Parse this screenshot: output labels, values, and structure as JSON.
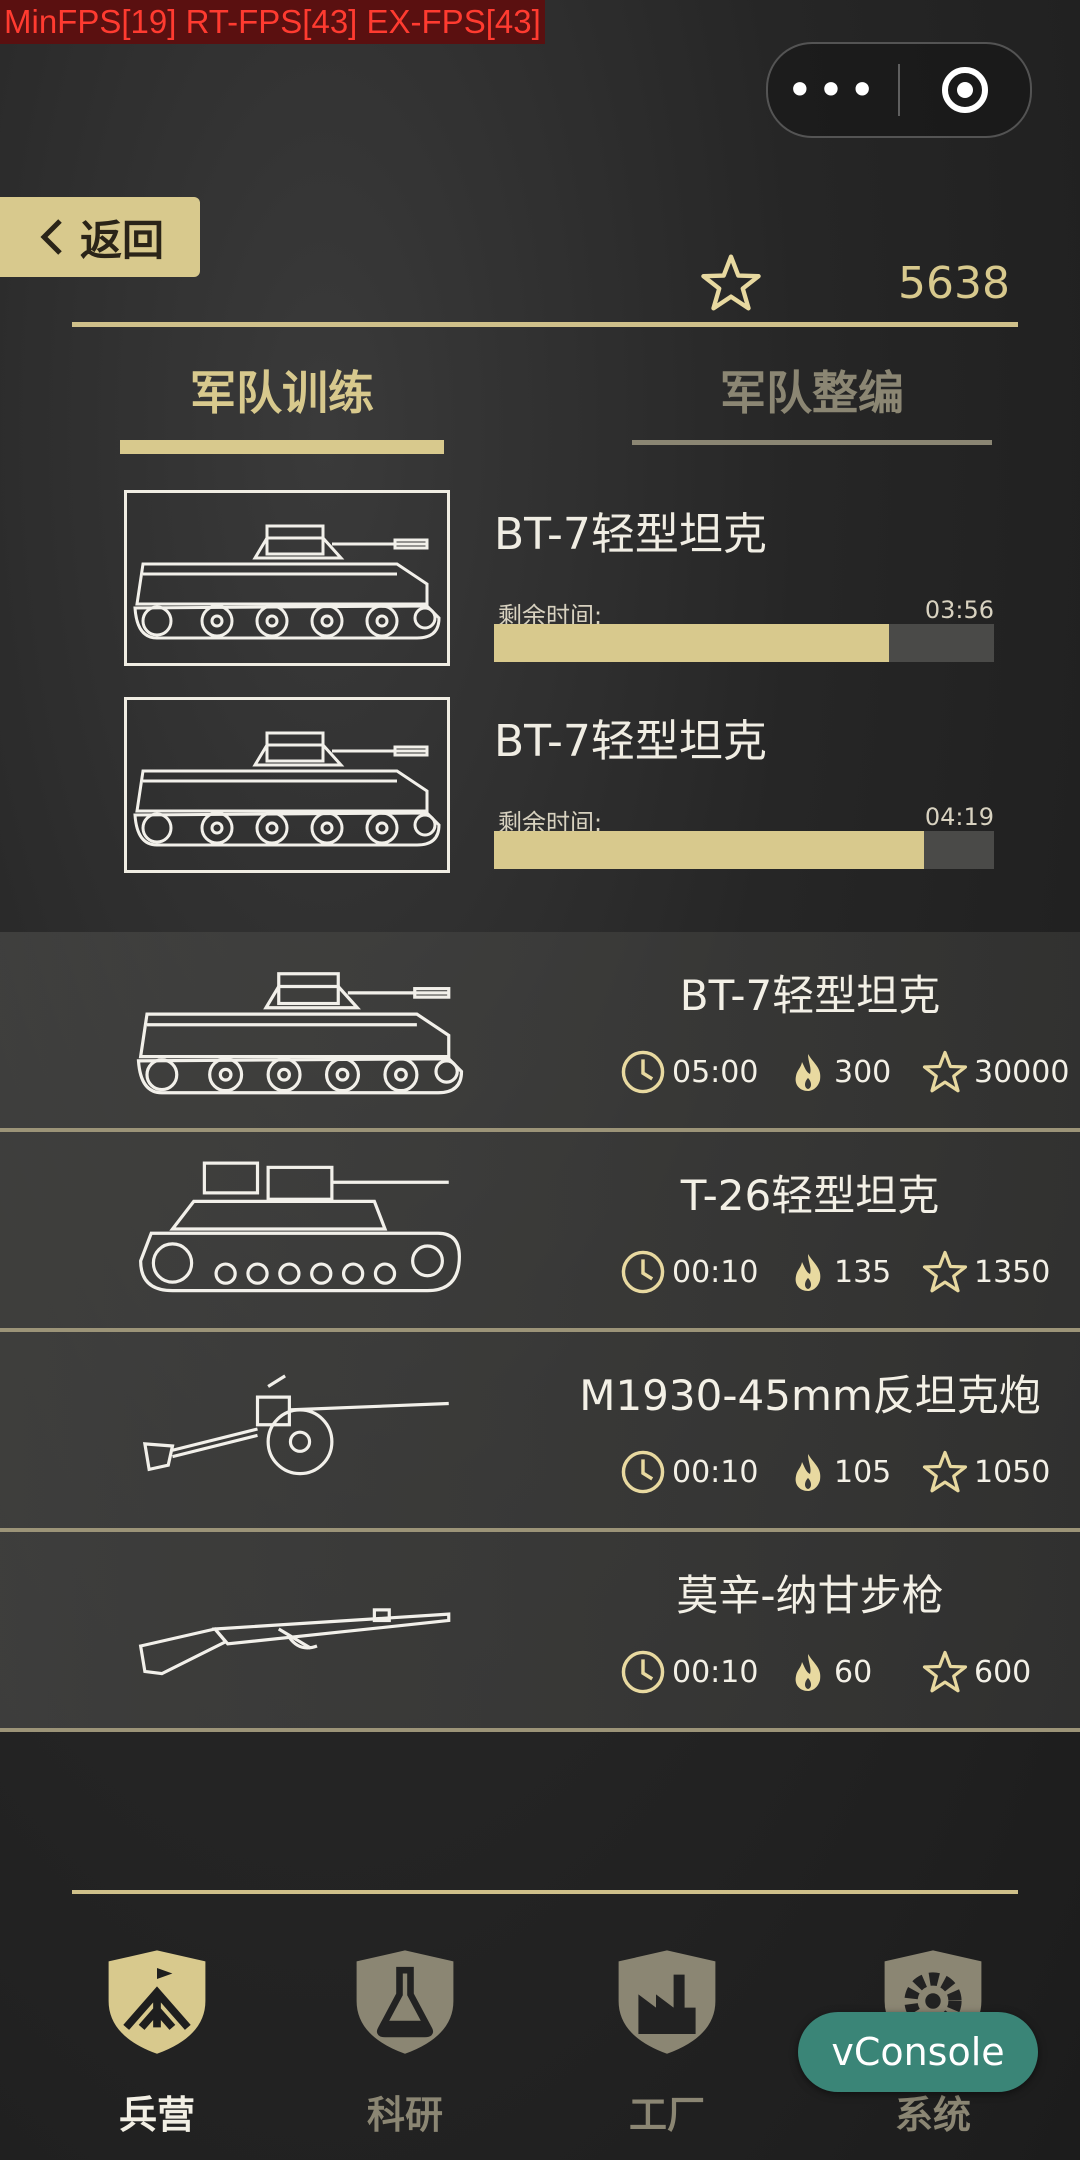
{
  "debug": {
    "fps_text": "MinFPS[19] RT-FPS[43] EX-FPS[43]"
  },
  "capsule": {
    "more_icon": "more-dots-icon",
    "close_icon": "target-icon"
  },
  "header": {
    "back_label": "返回",
    "score": "5638",
    "colors": {
      "accent": "#d8c98d",
      "text": "#e8e4d8"
    }
  },
  "tabs": [
    {
      "label": "军队训练",
      "active": true
    },
    {
      "label": "军队整编",
      "active": false
    }
  ],
  "queue": [
    {
      "name": "BT-7轻型坦克",
      "remaining_label": "剩余时间:",
      "remaining_time": "03:56",
      "progress": 0.79
    },
    {
      "name": "BT-7轻型坦克",
      "remaining_label": "剩余时间:",
      "remaining_time": "04:19",
      "progress": 0.86
    }
  ],
  "units": [
    {
      "name": "BT-7轻型坦克",
      "time": "05:00",
      "fuel": "300",
      "stars": "30000",
      "icon": "bt7-tank-icon"
    },
    {
      "name": "T-26轻型坦克",
      "time": "00:10",
      "fuel": "135",
      "stars": "1350",
      "icon": "t26-tank-icon"
    },
    {
      "name": "M1930-45mm反坦克炮",
      "time": "00:10",
      "fuel": "105",
      "stars": "1050",
      "icon": "antitank-gun-icon"
    },
    {
      "name": "莫辛-纳甘步枪",
      "time": "00:10",
      "fuel": "60",
      "stars": "600",
      "icon": "rifle-icon"
    }
  ],
  "nav": [
    {
      "label": "兵营",
      "active": true,
      "icon": "barracks-icon"
    },
    {
      "label": "科研",
      "active": false,
      "icon": "flask-icon"
    },
    {
      "label": "工厂",
      "active": false,
      "icon": "factory-icon"
    },
    {
      "label": "系统",
      "active": false,
      "icon": "gear-icon"
    }
  ],
  "vconsole": {
    "label": "vConsole"
  }
}
